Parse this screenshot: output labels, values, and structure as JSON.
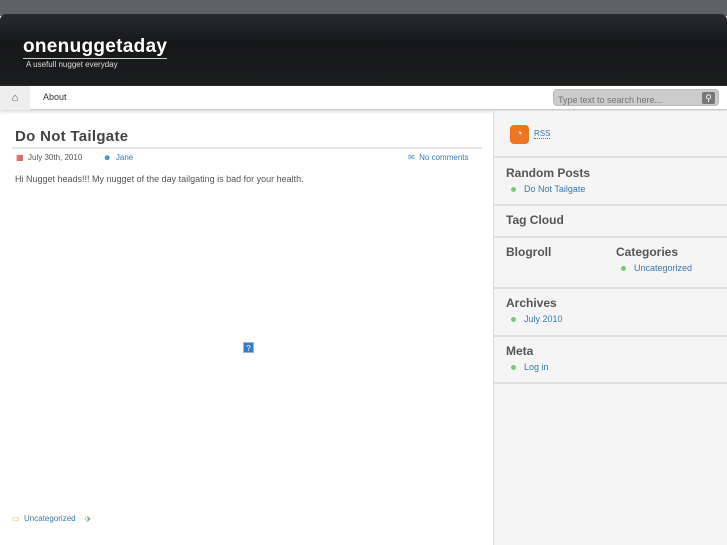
{
  "header": {
    "title": "onenuggetaday",
    "tagline": "A usefull nugget everyday"
  },
  "nav": {
    "home": "⌂",
    "about": "About",
    "search_placeholder": "Type text to search here..."
  },
  "post": {
    "title": "Do Not Tailgate",
    "date": "July 30th, 2010",
    "author": "Jane",
    "comments": "No comments",
    "body": "Hi Nugget heads!!! My nugget of the day tailgating is bad for your health.",
    "category": "Uncategorized",
    "image_placeholder": "?"
  },
  "sidebar": {
    "rss": "RSS",
    "random_posts": {
      "title": "Random Posts",
      "items": [
        "Do Not Tailgate"
      ]
    },
    "tag_cloud": {
      "title": "Tag Cloud"
    },
    "blogroll": {
      "title": "Blogroll"
    },
    "categories": {
      "title": "Categories",
      "items": [
        "Uncategorized"
      ]
    },
    "archives": {
      "title": "Archives",
      "items": [
        "July 2010"
      ]
    },
    "meta": {
      "title": "Meta",
      "items": [
        "Log in"
      ]
    }
  }
}
